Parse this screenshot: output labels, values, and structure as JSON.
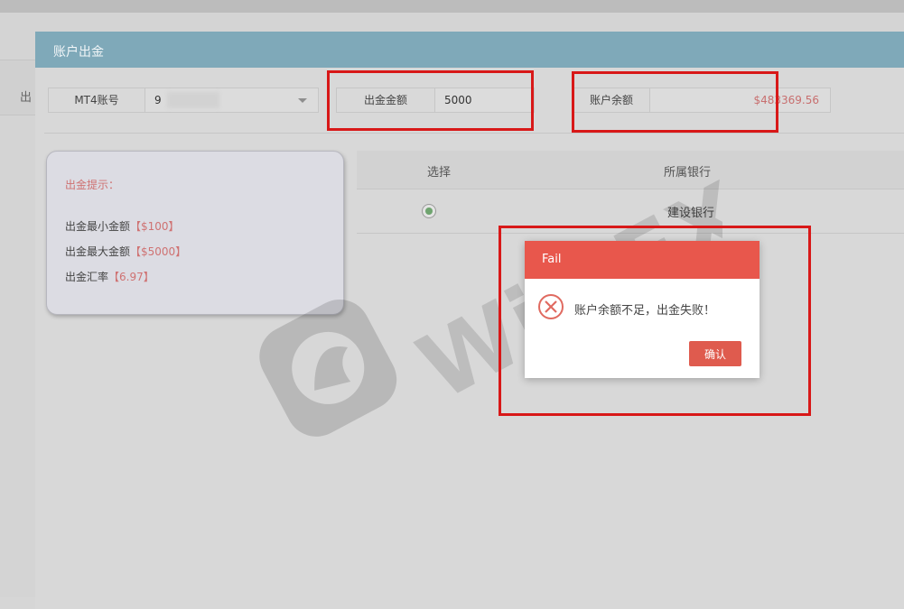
{
  "background_page": {
    "left_label": "出"
  },
  "modal": {
    "title": "账户出金",
    "mt4_field": {
      "label": "MT4账号",
      "value": "9"
    },
    "amount_field": {
      "label": "出金金额",
      "value": "5000"
    },
    "balance_field": {
      "label": "账户余额",
      "value": "$483369.56"
    },
    "tips": {
      "title": "出金提示：",
      "items": [
        {
          "label": "出金最小金额",
          "value": "【$100】"
        },
        {
          "label": "出金最大金额",
          "value": "【$5000】"
        },
        {
          "label": "出金汇率",
          "value": "【6.97】"
        }
      ]
    },
    "bank_table": {
      "headers": {
        "select": "选择",
        "bank": "所属银行"
      },
      "rows": [
        {
          "bank": "建设银行",
          "selected": true
        }
      ]
    }
  },
  "dialog": {
    "title": "Fail",
    "message": "账户余额不足，出金失败！",
    "ok_label": "确认"
  },
  "watermark": {
    "text": "WikiFX",
    "icon": "eagle-shield-icon"
  },
  "colors": {
    "modal_header": "#7fa9b9",
    "dialog_header": "#e8574c",
    "accent_red": "#cf7272",
    "annotation_red": "#d81818"
  }
}
